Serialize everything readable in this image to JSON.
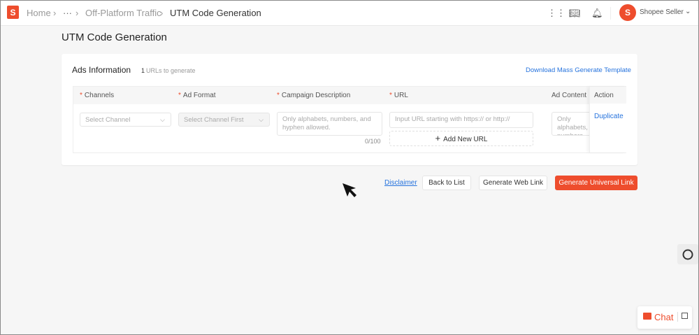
{
  "header": {
    "logo": "S",
    "breadcrumb": [
      "Home",
      "···",
      "Off-Platform Traffic",
      "UTM Code Generation"
    ],
    "icons": [
      "apps-grid-icon",
      "book-icon",
      "bell-icon"
    ],
    "user": "Shopee Seller"
  },
  "page": {
    "title": "UTM Code Generation"
  },
  "card": {
    "title": "Ads Information",
    "count": "1",
    "count_label": "URLs to generate",
    "template_link": "Download Mass Generate Template"
  },
  "table": {
    "columns": [
      {
        "label": "Channels",
        "required": true
      },
      {
        "label": "Ad Format",
        "required": true
      },
      {
        "label": "Campaign Description",
        "required": true
      },
      {
        "label": "URL",
        "required": true
      },
      {
        "label": "Ad Content",
        "required": false
      },
      {
        "label": "Action",
        "required": false
      }
    ],
    "row": {
      "channel_placeholder": "Select Channel",
      "format_placeholder": "Select Channel First",
      "description_placeholder": "Only alphabets, numbers, and hyphen allowed.",
      "description_count": "0/100",
      "url_placeholder": "Input URL starting with https:// or http://",
      "add_url": "Add New URL",
      "content_placeholder": "Only alphabets, numbers, and hyphen allowed.",
      "action": "Duplicate"
    }
  },
  "actions": {
    "disclaimer": "Disclaimer",
    "back": "Back to List",
    "web": "Generate Web Link",
    "universal": "Generate Universal Link"
  },
  "chat": {
    "label": "Chat"
  },
  "colors": {
    "brand": "#ee4d2d",
    "link": "#2673dd"
  }
}
